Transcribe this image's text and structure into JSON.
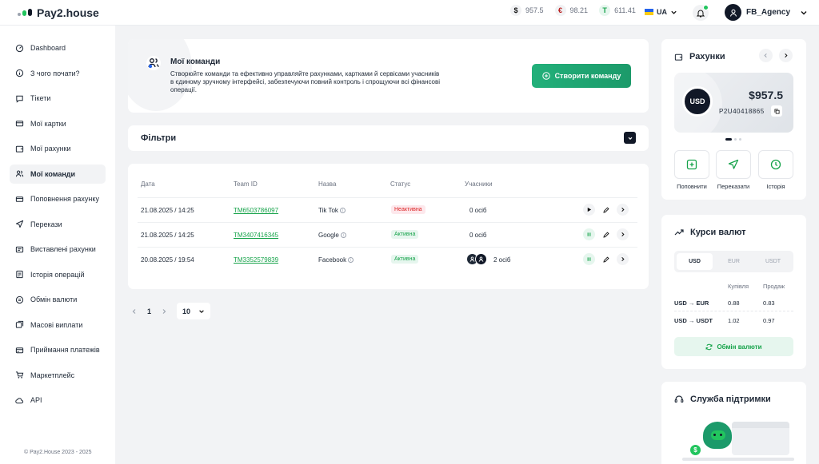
{
  "header": {
    "logo": "Pay2.house",
    "balances": [
      {
        "symbol": "$",
        "value": "957.5"
      },
      {
        "symbol": "€",
        "value": "98.21"
      },
      {
        "symbol": "T",
        "value": "611.41"
      }
    ],
    "language": "UA",
    "user": "FB_Agency"
  },
  "sidebar": {
    "items": [
      {
        "label": "Dashboard"
      },
      {
        "label": "З чого почати?"
      },
      {
        "label": "Тікети"
      },
      {
        "label": "Мої картки"
      },
      {
        "label": "Мої рахунки"
      },
      {
        "label": "Мої команди"
      },
      {
        "label": "Поповнення рахунку"
      },
      {
        "label": "Перекази"
      },
      {
        "label": "Виставлені рахунки"
      },
      {
        "label": "Історія операцій"
      },
      {
        "label": "Обмін валюти"
      },
      {
        "label": "Масові виплати"
      },
      {
        "label": "Приймання платежів"
      },
      {
        "label": "Маркетплейс"
      },
      {
        "label": "API"
      }
    ],
    "active_index": 5,
    "copyright": "© Pay2.House 2023 - 2025"
  },
  "hero": {
    "title": "Мої команди",
    "description": "Створюйте команди та ефективно управляйте рахунками, картками й сервісами учасників в єдиному зручному інтерфейсі, забезпечуючи повний контроль і спрощуючи всі фінансові операції.",
    "create_button": "Створити команду"
  },
  "filters": {
    "title": "Фільтри"
  },
  "table": {
    "headers": [
      "Дата",
      "Team ID",
      "Назва",
      "Статус",
      "Учасники"
    ],
    "rows": [
      {
        "date": "21.08.2025 / 14:25",
        "team_id": "TM6503786097",
        "name": "Tik Tok",
        "status": "Неактивна",
        "members": "0 осіб"
      },
      {
        "date": "21.08.2025 / 14:25",
        "team_id": "TM3407416345",
        "name": "Google",
        "status": "Активна",
        "members": "0 осіб"
      },
      {
        "date": "20.08.2025 / 19:54",
        "team_id": "TM3352579839",
        "name": "Facebook",
        "status": "Активна",
        "members": "2 осіб"
      }
    ]
  },
  "pagination": {
    "current": "1",
    "per_page": "10"
  },
  "accounts": {
    "title": "Рахунки",
    "currency": "USD",
    "amount": "$957.5",
    "account_id": "P2U40418865",
    "actions": [
      "Поповнити",
      "Переказати",
      "Історія"
    ]
  },
  "rates": {
    "title": "Курси валют",
    "tabs": [
      "USD",
      "EUR",
      "USDT"
    ],
    "buy_label": "Купівля",
    "sell_label": "Продаж",
    "rows": [
      {
        "pair": "USD → EUR",
        "buy": "0.88",
        "sell": "0.83"
      },
      {
        "pair": "USD → USDT",
        "buy": "1.02",
        "sell": "0.97"
      }
    ],
    "exchange_button": "Обмін валюти"
  },
  "support": {
    "title": "Служба підтримки"
  }
}
